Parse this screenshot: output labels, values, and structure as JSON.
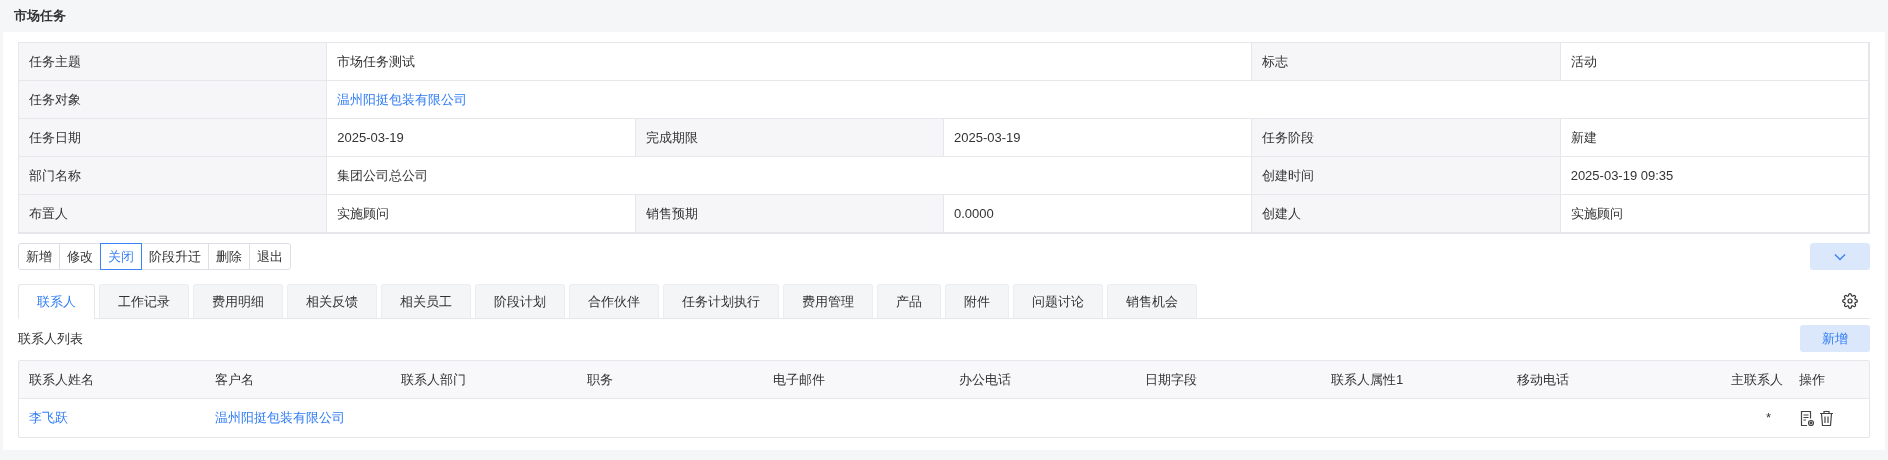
{
  "title": "市场任务",
  "form": {
    "rows": [
      [
        {
          "label": "任务主题",
          "value": "市场任务测试"
        },
        {
          "label": "标志",
          "value": "活动"
        }
      ],
      [
        {
          "label": "任务对象",
          "value": "温州阳挺包装有限公司",
          "link": true
        }
      ],
      [
        {
          "label": "任务日期",
          "value": "2025-03-19"
        },
        {
          "label": "完成期限",
          "value": "2025-03-19"
        },
        {
          "label": "任务阶段",
          "value": "新建"
        }
      ],
      [
        {
          "label": "部门名称",
          "value": "集团公司总公司"
        },
        {
          "label": "创建时间",
          "value": "2025-03-19 09:35"
        }
      ],
      [
        {
          "label": "布置人",
          "value": "实施顾问"
        },
        {
          "label": "销售预期",
          "value": "0.0000"
        },
        {
          "label": "创建人",
          "value": "实施顾问"
        }
      ]
    ]
  },
  "actions": [
    {
      "label": "新增",
      "selected": false
    },
    {
      "label": "修改",
      "selected": false
    },
    {
      "label": "关闭",
      "selected": true
    },
    {
      "label": "阶段升迁",
      "selected": false
    },
    {
      "label": "删除",
      "selected": false
    },
    {
      "label": "退出",
      "selected": false
    }
  ],
  "tabs": [
    {
      "label": "联系人",
      "selected": true
    },
    {
      "label": "工作记录",
      "selected": false
    },
    {
      "label": "费用明细",
      "selected": false
    },
    {
      "label": "相关反馈",
      "selected": false
    },
    {
      "label": "相关员工",
      "selected": false
    },
    {
      "label": "阶段计划",
      "selected": false
    },
    {
      "label": "合作伙伴",
      "selected": false
    },
    {
      "label": "任务计划执行",
      "selected": false
    },
    {
      "label": "费用管理",
      "selected": false
    },
    {
      "label": "产品",
      "selected": false
    },
    {
      "label": "附件",
      "selected": false
    },
    {
      "label": "问题讨论",
      "selected": false
    },
    {
      "label": "销售机会",
      "selected": false
    }
  ],
  "list": {
    "title": "联系人列表",
    "add_button": "新增",
    "columns": [
      "联系人姓名",
      "客户名",
      "联系人部门",
      "职务",
      "电子邮件",
      "办公电话",
      "日期字段",
      "联系人属性1",
      "移动电话",
      "主联系人",
      "操作"
    ],
    "rows": [
      {
        "name": "李飞跃",
        "customer": "温州阳挺包装有限公司",
        "primary": "*"
      }
    ]
  }
}
